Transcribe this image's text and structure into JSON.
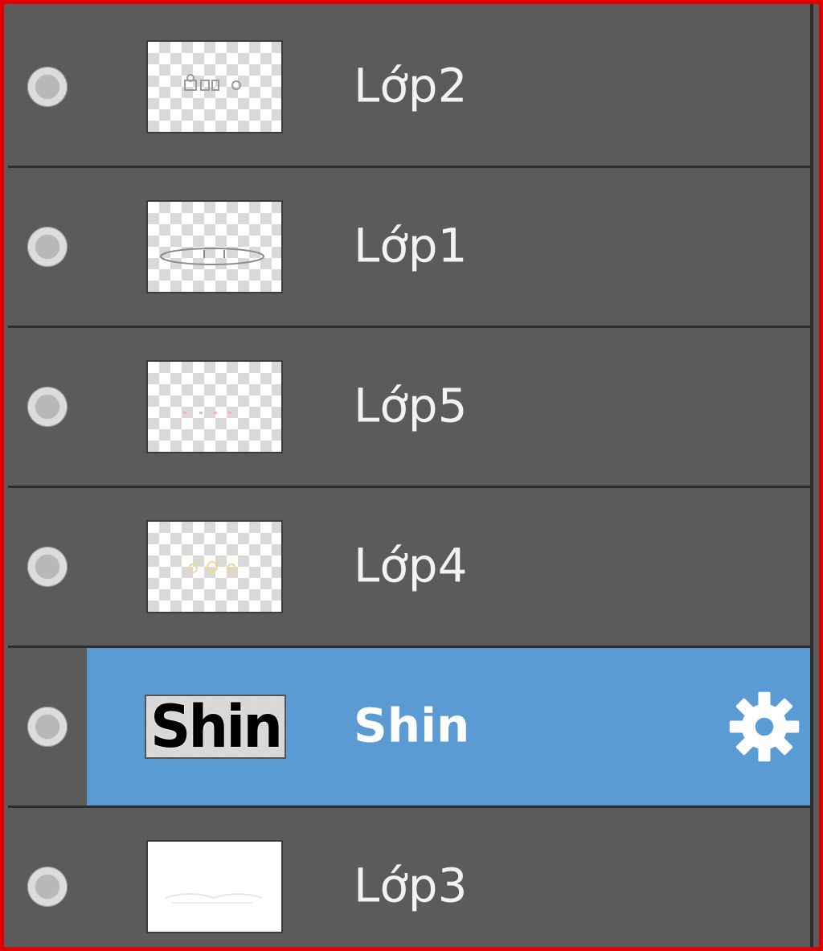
{
  "layers_panel": {
    "layers": [
      {
        "name": "Lớp2",
        "thumbnail": "transparent-with-small-text",
        "selected": false
      },
      {
        "name": "Lớp1",
        "thumbnail": "transparent-with-oval-outline",
        "selected": false
      },
      {
        "name": "Lớp5",
        "thumbnail": "transparent-with-faint-red-marks",
        "selected": false
      },
      {
        "name": "Lớp4",
        "thumbnail": "transparent-with-faint-yellow-marks",
        "selected": false
      },
      {
        "name": "Shin",
        "thumbnail": "text-layer",
        "thumbnail_text": "Shin",
        "selected": true,
        "settings_icon": "gear-icon"
      },
      {
        "name": "Lớp3",
        "thumbnail": "white-with-faint-outline",
        "selected": false
      }
    ],
    "colors": {
      "panel_bg": "#5b5b5b",
      "selected_bg": "#5a9bd4",
      "divider": "#2e2e2e",
      "frame_border": "#e00000",
      "text": "#f2f2f2"
    }
  }
}
